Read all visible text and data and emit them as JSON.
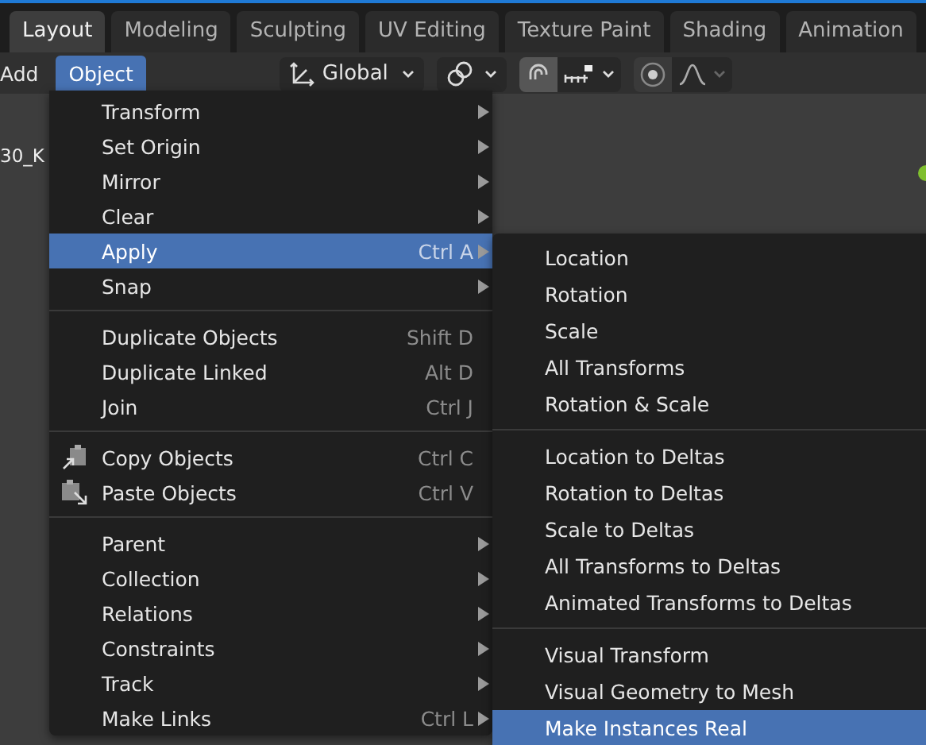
{
  "tabs": [
    {
      "label": "Layout",
      "selected": true
    },
    {
      "label": "Modeling",
      "selected": false
    },
    {
      "label": "Sculpting",
      "selected": false
    },
    {
      "label": "UV Editing",
      "selected": false
    },
    {
      "label": "Texture Paint",
      "selected": false
    },
    {
      "label": "Shading",
      "selected": false
    },
    {
      "label": "Animation",
      "selected": false
    }
  ],
  "header": {
    "menus": [
      {
        "label": "Add",
        "selected": false
      },
      {
        "label": "Object",
        "selected": true
      }
    ],
    "orientation": "Global",
    "snap_on": true,
    "proportional_on": false
  },
  "viewport": {
    "object_name": "30_K"
  },
  "object_menu": {
    "sections": [
      [
        {
          "kind": "plain",
          "label": "Transform",
          "submenu": true,
          "selected": false
        },
        {
          "kind": "plain",
          "label": "Set Origin",
          "submenu": true,
          "selected": false
        },
        {
          "kind": "plain",
          "label": "Mirror",
          "submenu": true,
          "selected": false
        },
        {
          "kind": "plain",
          "label": "Clear",
          "submenu": true,
          "selected": false
        },
        {
          "kind": "plain",
          "label": "Apply",
          "shortcut": "Ctrl A",
          "submenu": true,
          "selected": true
        },
        {
          "kind": "plain",
          "label": "Snap",
          "submenu": true,
          "selected": false
        }
      ],
      [
        {
          "kind": "plain",
          "label": "Duplicate Objects",
          "shortcut": "Shift D",
          "submenu": false,
          "selected": false
        },
        {
          "kind": "plain",
          "label": "Duplicate Linked",
          "shortcut": "Alt D",
          "submenu": false,
          "selected": false
        },
        {
          "kind": "plain",
          "label": "Join",
          "shortcut": "Ctrl J",
          "submenu": false,
          "selected": false
        }
      ],
      [
        {
          "kind": "copy",
          "label": "Copy Objects",
          "shortcut": "Ctrl C",
          "submenu": false,
          "selected": false
        },
        {
          "kind": "paste",
          "label": "Paste Objects",
          "shortcut": "Ctrl V",
          "submenu": false,
          "selected": false
        }
      ],
      [
        {
          "kind": "plain",
          "label": "Parent",
          "submenu": true,
          "selected": false
        },
        {
          "kind": "plain",
          "label": "Collection",
          "submenu": true,
          "selected": false
        },
        {
          "kind": "plain",
          "label": "Relations",
          "submenu": true,
          "selected": false
        },
        {
          "kind": "plain",
          "label": "Constraints",
          "submenu": true,
          "selected": false
        },
        {
          "kind": "plain",
          "label": "Track",
          "submenu": true,
          "selected": false
        },
        {
          "kind": "plain",
          "label": "Make Links",
          "shortcut": "Ctrl L",
          "submenu": true,
          "selected": false
        }
      ]
    ]
  },
  "apply_menu": {
    "sections": [
      [
        {
          "label": "Location",
          "selected": false
        },
        {
          "label": "Rotation",
          "selected": false
        },
        {
          "label": "Scale",
          "selected": false
        },
        {
          "label": "All Transforms",
          "selected": false
        },
        {
          "label": "Rotation & Scale",
          "selected": false
        }
      ],
      [
        {
          "label": "Location to Deltas",
          "selected": false
        },
        {
          "label": "Rotation to Deltas",
          "selected": false
        },
        {
          "label": "Scale to Deltas",
          "selected": false
        },
        {
          "label": "All Transforms to Deltas",
          "selected": false
        },
        {
          "label": "Animated Transforms to Deltas",
          "selected": false
        }
      ],
      [
        {
          "label": "Visual Transform",
          "selected": false
        },
        {
          "label": "Visual Geometry to Mesh",
          "selected": false
        },
        {
          "label": "Make Instances Real",
          "selected": true
        }
      ]
    ]
  }
}
